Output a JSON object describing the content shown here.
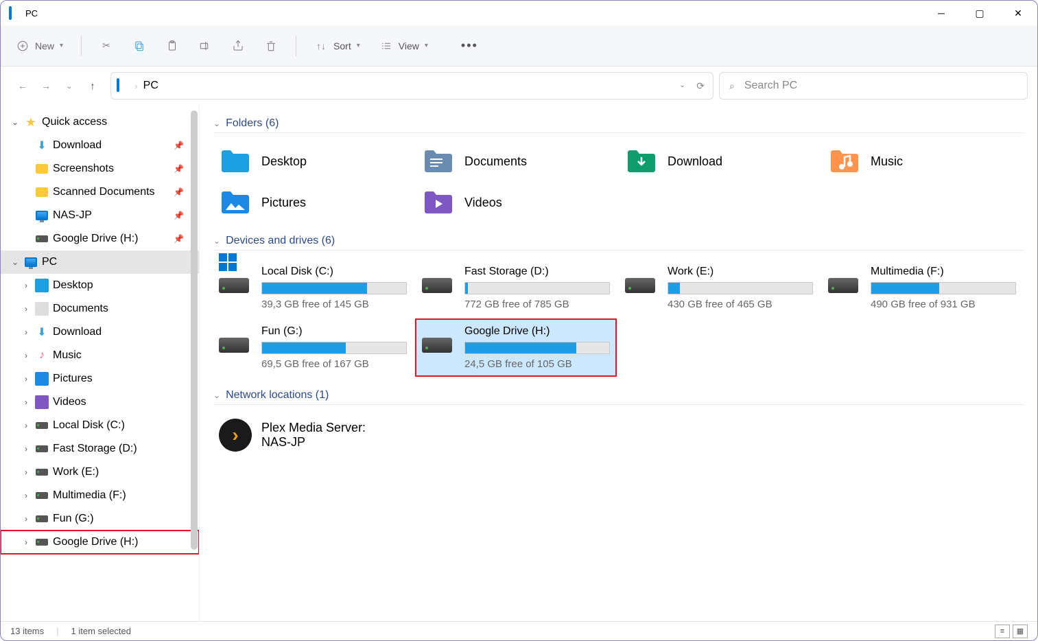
{
  "window": {
    "title": "PC"
  },
  "toolbar": {
    "new_label": "New",
    "sort_label": "Sort",
    "view_label": "View"
  },
  "addressbar": {
    "location": "PC",
    "search_placeholder": "Search PC"
  },
  "sidebar": {
    "quick_access": "Quick access",
    "qa_items": [
      {
        "label": "Download"
      },
      {
        "label": "Screenshots"
      },
      {
        "label": "Scanned Documents"
      },
      {
        "label": "NAS-JP"
      },
      {
        "label": "Google Drive (H:)"
      }
    ],
    "pc_label": "PC",
    "pc_items": [
      {
        "label": "Desktop"
      },
      {
        "label": "Documents"
      },
      {
        "label": "Download"
      },
      {
        "label": "Music"
      },
      {
        "label": "Pictures"
      },
      {
        "label": "Videos"
      },
      {
        "label": "Local Disk (C:)"
      },
      {
        "label": "Fast Storage (D:)"
      },
      {
        "label": "Work (E:)"
      },
      {
        "label": "Multimedia (F:)"
      },
      {
        "label": "Fun (G:)"
      },
      {
        "label": "Google Drive (H:)"
      }
    ]
  },
  "sections": {
    "folders_header": "Folders (6)",
    "drives_header": "Devices and drives (6)",
    "network_header": "Network locations (1)"
  },
  "folders": [
    {
      "name": "Desktop",
      "color": "#1ba1e2"
    },
    {
      "name": "Documents",
      "color": "#6a8caf"
    },
    {
      "name": "Download",
      "color": "#0e9e6e"
    },
    {
      "name": "Music",
      "color": "#f06292"
    },
    {
      "name": "Pictures",
      "color": "#1e88e5"
    },
    {
      "name": "Videos",
      "color": "#7e57c2"
    }
  ],
  "drives": [
    {
      "name": "Local Disk (C:)",
      "free": "39,3 GB free of 145 GB",
      "pct": 73
    },
    {
      "name": "Fast Storage (D:)",
      "free": "772 GB free of 785 GB",
      "pct": 2
    },
    {
      "name": "Work (E:)",
      "free": "430 GB free of 465 GB",
      "pct": 8
    },
    {
      "name": "Multimedia (F:)",
      "free": "490 GB free of 931 GB",
      "pct": 47
    },
    {
      "name": "Fun (G:)",
      "free": "69,5 GB free of 167 GB",
      "pct": 58
    },
    {
      "name": "Google Drive (H:)",
      "free": "24,5 GB free of 105 GB",
      "pct": 77,
      "selected": true
    }
  ],
  "network": {
    "name_line1": "Plex Media Server:",
    "name_line2": "NAS-JP"
  },
  "statusbar": {
    "count": "13 items",
    "selected": "1 item selected"
  }
}
